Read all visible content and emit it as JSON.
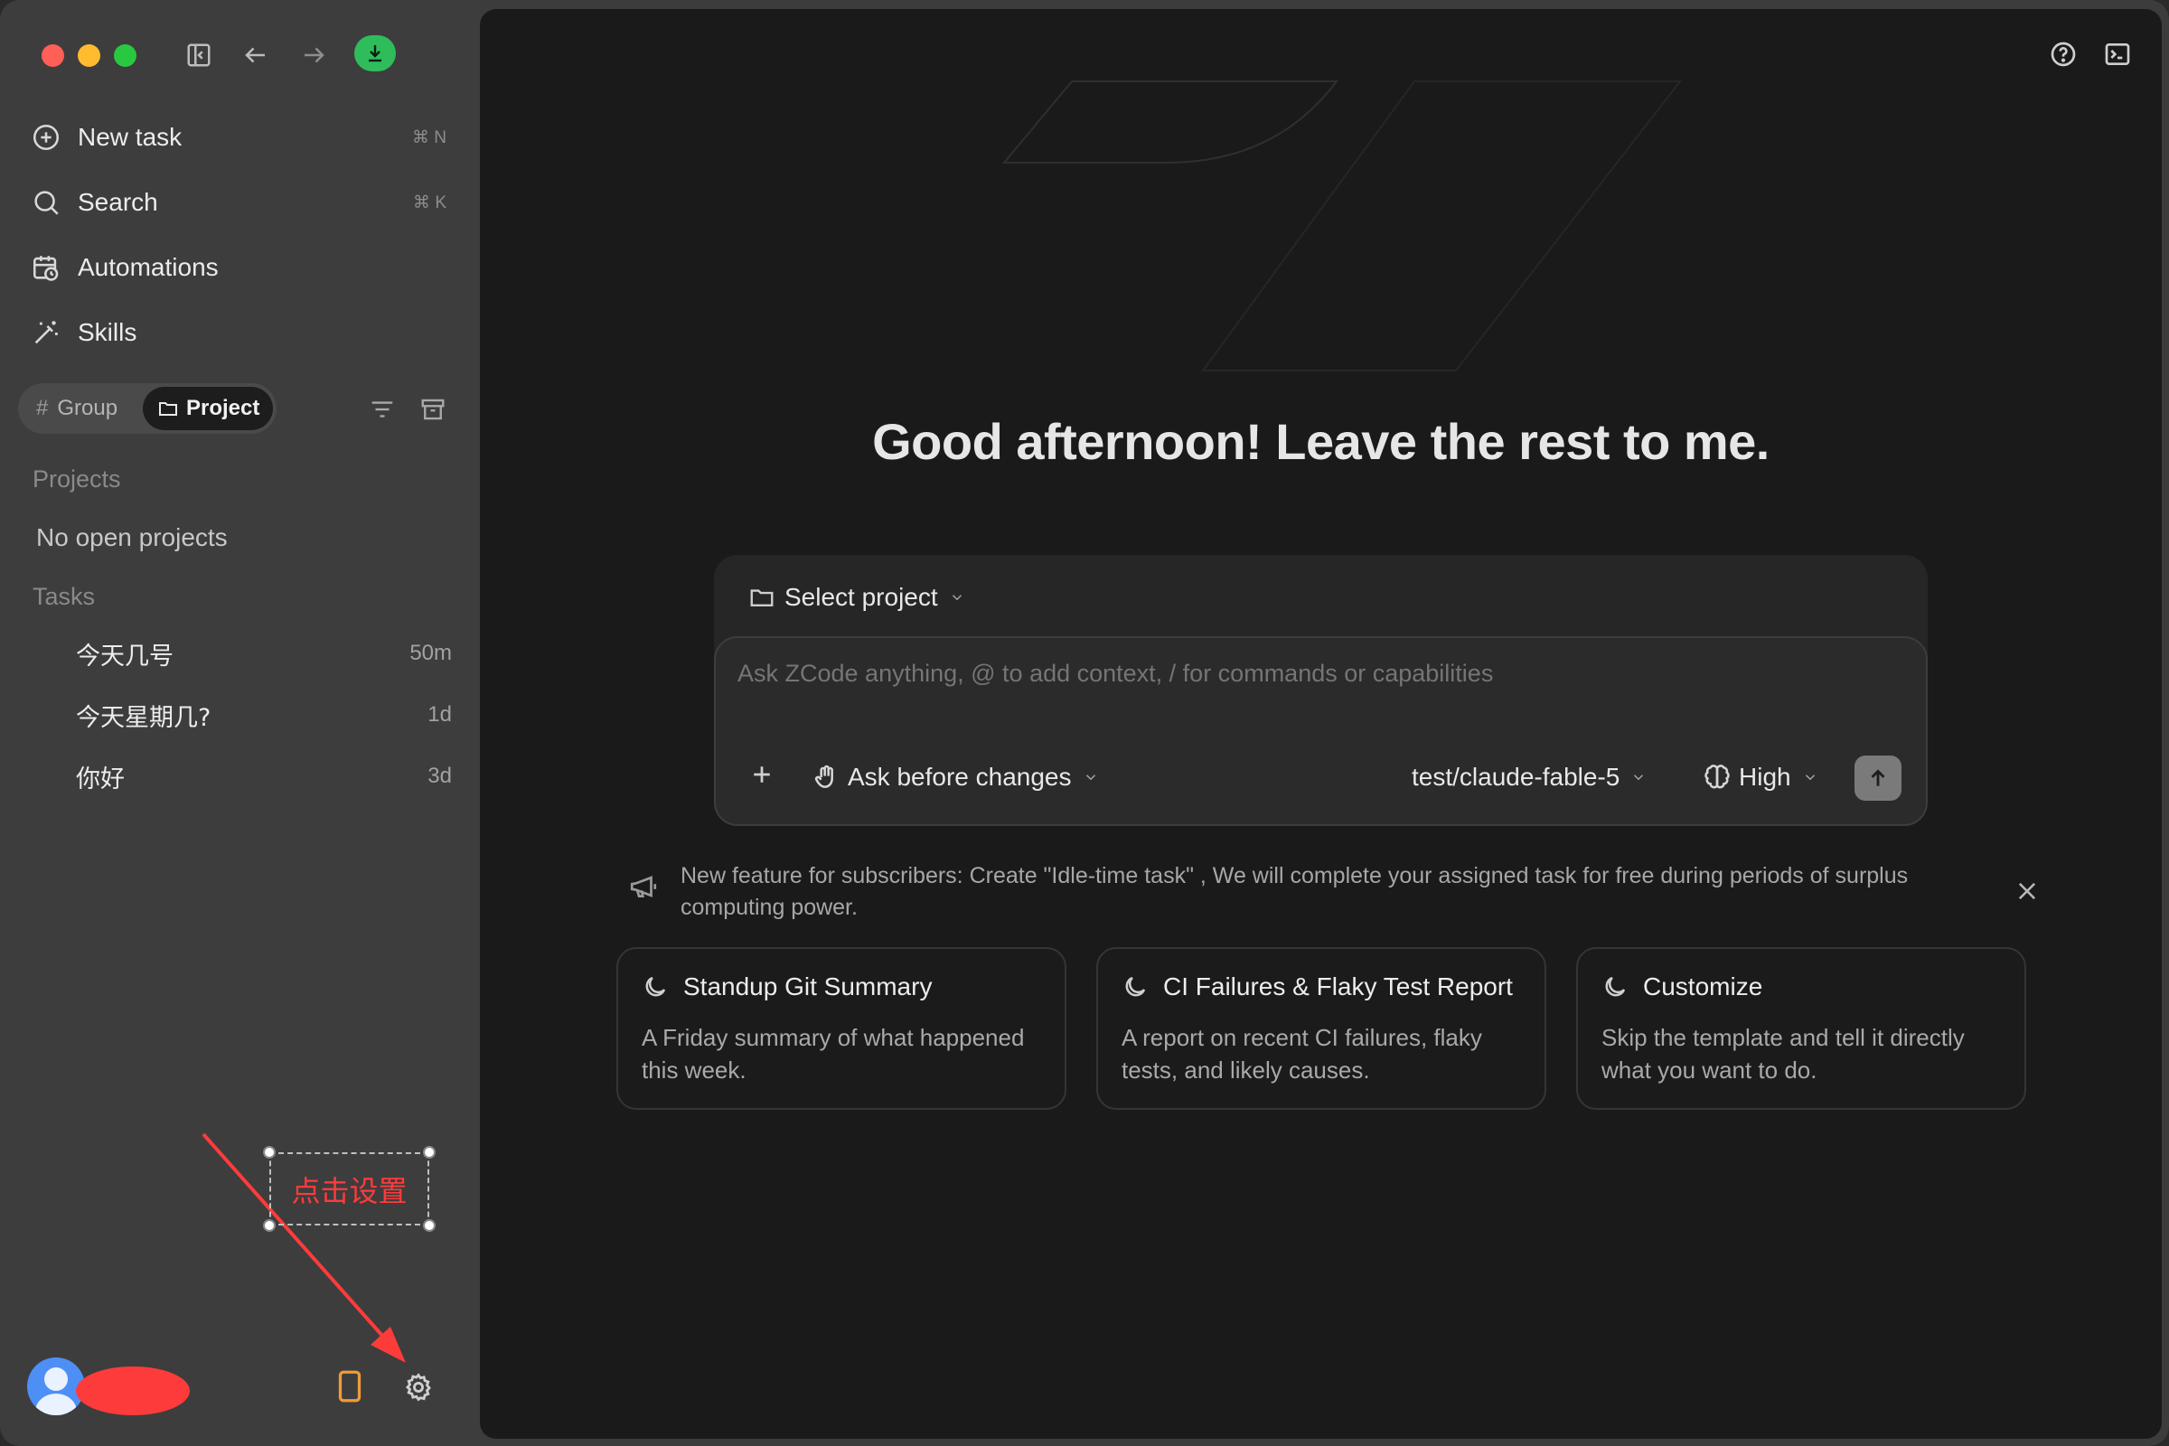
{
  "window": {
    "controls": [
      "close",
      "minimize",
      "zoom"
    ]
  },
  "toolbar": {
    "icons": [
      "sidebar-toggle-icon",
      "back-arrow-icon",
      "forward-arrow-icon",
      "download-icon"
    ],
    "accent_green": "#2ebd5a"
  },
  "sidebar": {
    "nav": [
      {
        "label": "New task",
        "shortcut": "⌘ N",
        "icon": "plus-circle-icon"
      },
      {
        "label": "Search",
        "shortcut": "⌘ K",
        "icon": "search-icon"
      },
      {
        "label": "Automations",
        "shortcut": "",
        "icon": "calendar-clock-icon"
      },
      {
        "label": "Skills",
        "shortcut": "",
        "icon": "magic-wand-icon"
      }
    ],
    "segment": {
      "group_label": "Group",
      "group_prefix": "#",
      "project_label": "Project",
      "selected": "Project"
    },
    "tools": [
      "filter-icon",
      "archive-icon"
    ],
    "projects_heading": "Projects",
    "projects_empty": "No open projects",
    "tasks_heading": "Tasks",
    "tasks": [
      {
        "title": "今天几号",
        "age": "50m"
      },
      {
        "title": "今天星期几?",
        "age": "1d"
      },
      {
        "title": "你好",
        "age": "3d"
      }
    ],
    "annotation": {
      "text": "点击设置",
      "color": "#ff3b3b"
    },
    "footer": {
      "icons": [
        "avatar",
        "mobile-icon",
        "gear-icon"
      ],
      "mobile_icon_color": "#f09a3a",
      "redaction_color": "#fe3b3b"
    }
  },
  "header": {
    "icons": [
      "help-icon",
      "terminal-icon"
    ]
  },
  "main": {
    "greeting": "Good afternoon! Leave the rest to me.",
    "composer": {
      "select_project_label": "Select project",
      "placeholder": "Ask ZCode anything, @ to add context, / for commands or capabilities",
      "mode_label": "Ask before changes",
      "model_label": "test/claude-fable-5",
      "effort_label": "High"
    },
    "notice": {
      "text": "New feature for subscribers: Create \"Idle-time task\" , We will complete your assigned task for free during periods of surplus computing power."
    },
    "cards": [
      {
        "title": "Standup Git Summary",
        "desc": "A Friday summary of what happened this week.",
        "icon": "moon-icon"
      },
      {
        "title": "CI Failures & Flaky Test Report",
        "desc": "A report on recent CI failures, flaky tests, and likely causes.",
        "icon": "moon-icon"
      },
      {
        "title": "Customize",
        "desc": "Skip the template and tell it directly what you want to do.",
        "icon": "moon-icon"
      }
    ]
  }
}
